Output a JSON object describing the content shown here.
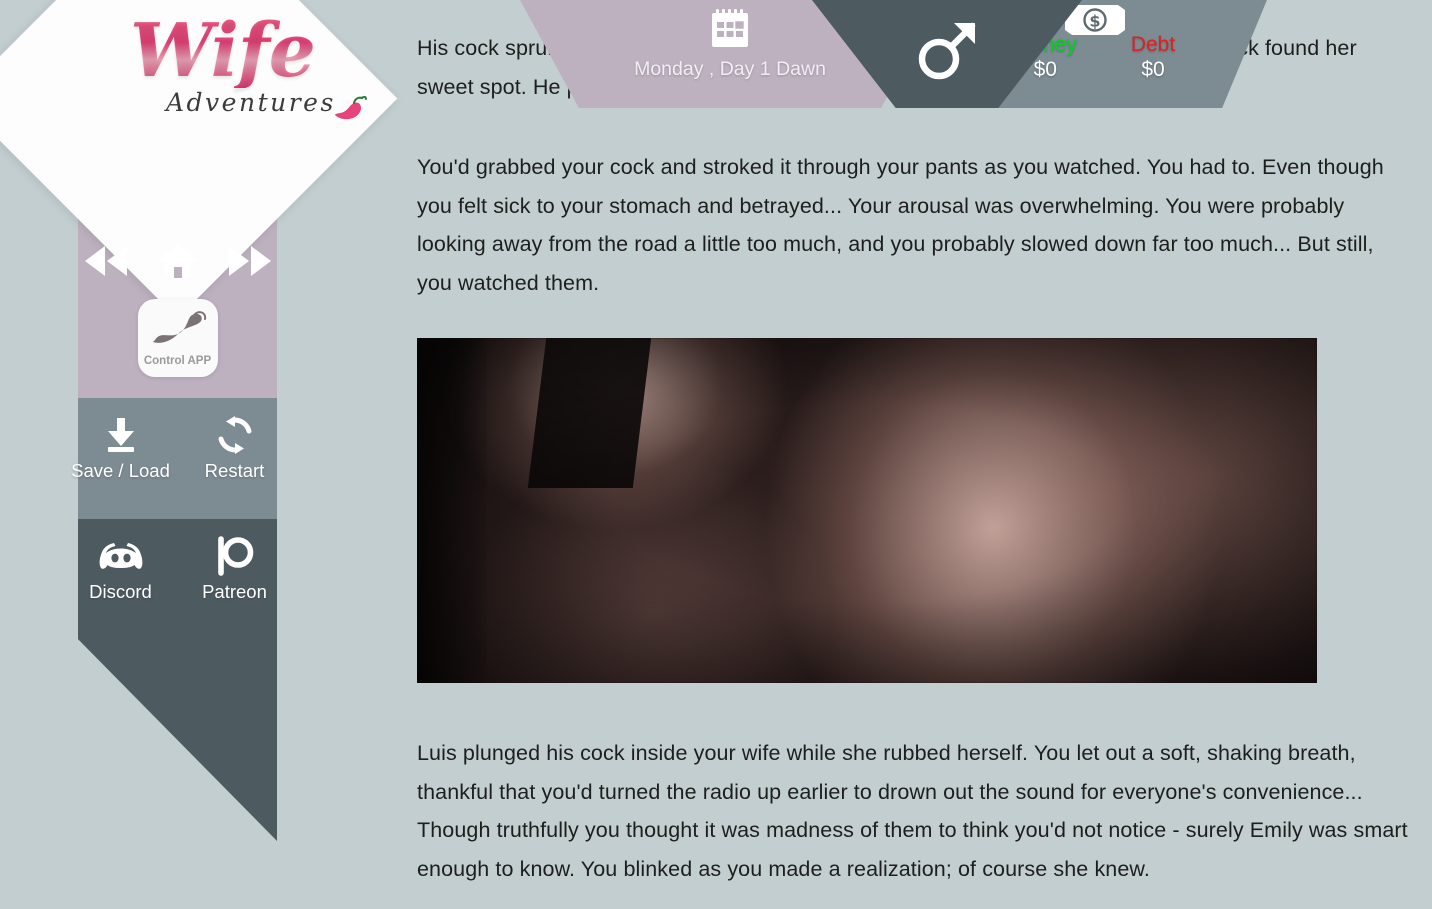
{
  "theme": {
    "background": "#c2ced0",
    "mauve": "#bdb1bf",
    "slate_dark": "#4d5a60",
    "slate_mid": "#7d8b93",
    "money_green": "#00d21e",
    "debt_red": "#e02020",
    "logo_pink": "#e8437a",
    "text_dark": "#1d1f1f"
  },
  "logo": {
    "title": "Wife",
    "subtitle": "Adventures",
    "icon": "chili-pepper-icon"
  },
  "hud": {
    "date": {
      "icon": "calendar-icon",
      "label": "Monday , Day 1 Dawn"
    },
    "gender": {
      "icon": "male-symbol-icon"
    },
    "money": {
      "icon": "banknote-icon",
      "cells": [
        {
          "label": "Money",
          "value": "$0",
          "color": "#00d21e"
        },
        {
          "label": "Debt",
          "value": "$0",
          "color": "#e02020"
        }
      ]
    }
  },
  "sidebar": {
    "nav": [
      {
        "name": "rewind-button",
        "icon": "rewind-icon"
      },
      {
        "name": "home-button",
        "icon": "home-icon"
      },
      {
        "name": "fast-forward-button",
        "icon": "fast-forward-icon"
      }
    ],
    "control_app": {
      "label": "Control APP",
      "icon": "vibrator-device-icon"
    },
    "tools": [
      {
        "label": "Save / Load",
        "icon": "download-icon"
      },
      {
        "label": "Restart",
        "icon": "refresh-icon"
      }
    ],
    "social": [
      {
        "label": "Discord",
        "icon": "discord-icon"
      },
      {
        "label": "Patreon",
        "icon": "patreon-icon"
      }
    ]
  },
  "story": {
    "paragraph_1": "His cock sprung                                              ick cock against her wet slit. You could see Emily grind her hips until           ck found her sweet spot. He plunged it inside her.",
    "paragraph_2": "You'd grabbed your cock and stroked it through your pants as you watched. You had to. Even though you felt sick to your stomach and betrayed... Your arousal was overwhelming. You were probably looking away from the road a little too much, and you probably slowed down far too much... But still, you watched them.",
    "paragraph_3": "Luis plunged his cock inside your wife while she rubbed herself. You let out a soft, shaking breath, thankful that you'd turned the radio up earlier to drown out the sound for everyone's convenience... Though truthfully you thought it was madness of them to think you'd not notice - surely Emily was smart enough to know. You blinked as you made a realization; of course she knew."
  },
  "media": {
    "alt": "scene-image-car-interior"
  }
}
